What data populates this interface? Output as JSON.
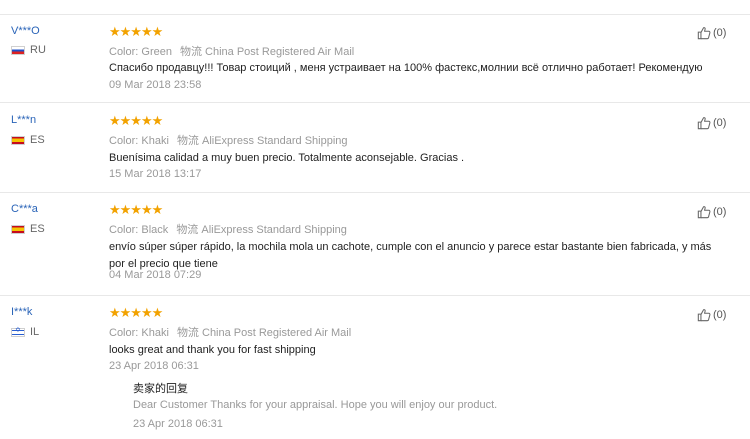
{
  "labels": {
    "color": "Color:",
    "logistics": "物流"
  },
  "reviews": [
    {
      "user": "V***O",
      "country": "RU",
      "flag": "ru",
      "stars": "★★★★★",
      "color": "Green",
      "shipping": "China Post Registered Air Mail",
      "text": "Спасибо продавцу!!! Товар стоиций , меня устраивает на 100% фастекс,молнии всё отлично работает! Рекомендую",
      "date": "09 Mar 2018 23:58",
      "likes": "(0)"
    },
    {
      "user": "L***n",
      "country": "ES",
      "flag": "es",
      "stars": "★★★★★",
      "color": "Khaki",
      "shipping": "AliExpress Standard Shipping",
      "text": "Buenísima calidad a muy buen precio. Totalmente aconsejable. Gracias .",
      "date": "15 Mar 2018 13:17",
      "likes": "(0)"
    },
    {
      "user": "C***a",
      "country": "ES",
      "flag": "es",
      "stars": "★★★★★",
      "color": "Black",
      "shipping": "AliExpress Standard Shipping",
      "text": "envío súper súper rápido, la mochila mola un cachote, cumple con el anuncio y parece estar bastante bien fabricada, y más por el precio que tiene",
      "date": "04 Mar 2018 07:29",
      "likes": "(0)"
    },
    {
      "user": "I***k",
      "country": "IL",
      "flag": "il",
      "stars": "★★★★★",
      "color": "Khaki",
      "shipping": "China Post Registered Air Mail",
      "text": "looks great and thank you for fast shipping",
      "date": "23 Apr 2018 06:31",
      "likes": "(0)",
      "reply": {
        "title": "卖家的回复",
        "text": "Dear Customer Thanks for your appraisal. Hope you will enjoy our product.",
        "date": "23 Apr 2018 06:31"
      }
    }
  ]
}
